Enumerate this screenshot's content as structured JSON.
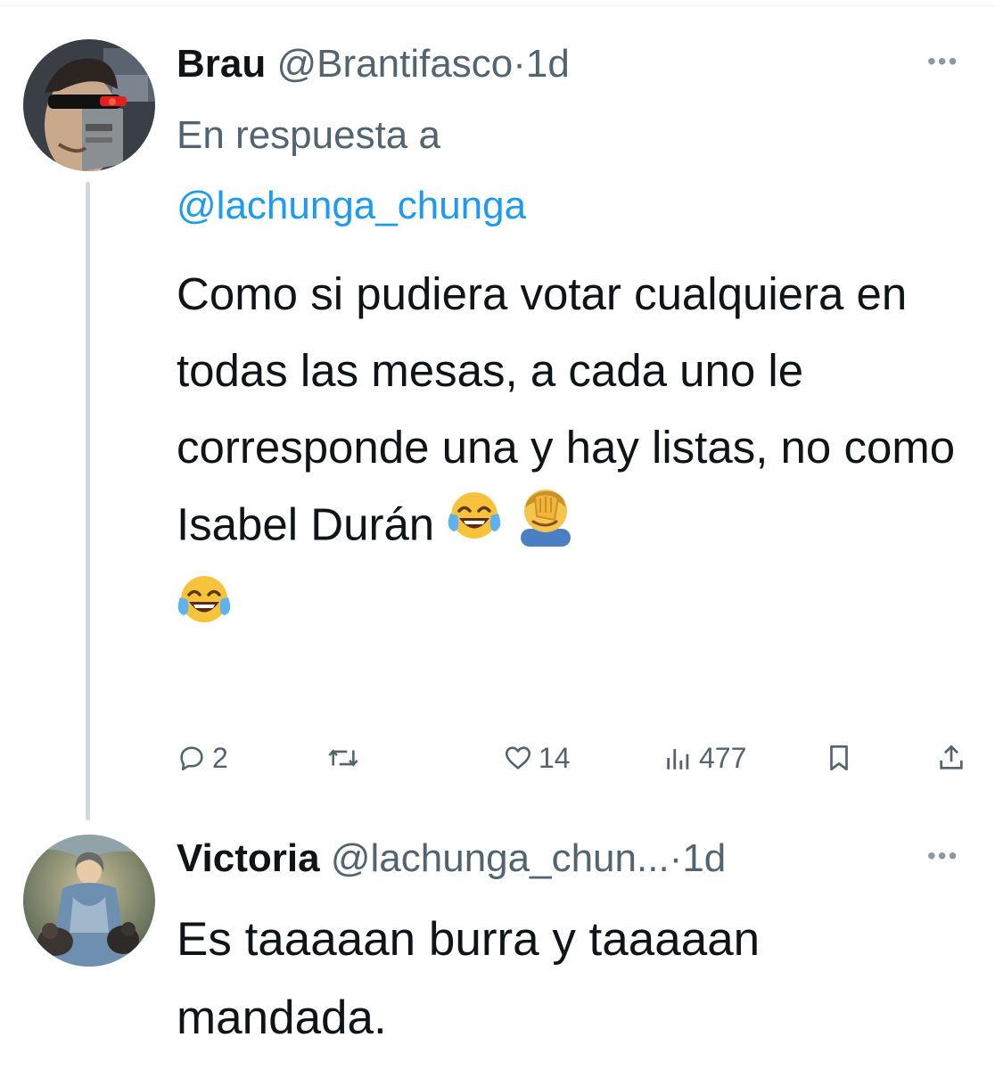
{
  "tweets": [
    {
      "author_name": "Brau",
      "author_handle": "@Brantifasco",
      "separator": "·",
      "time": "1d",
      "reply_label": "En respuesta a",
      "reply_to": "@lachunga_chunga",
      "text": "Como si pudiera votar cualquiera en todas las mesas, a cada uno le corresponde una y hay listas, no como Isabel Durán",
      "emojis": [
        "tears-of-joy-emoji",
        "facepalm-emoji",
        "tears-of-joy-emoji"
      ],
      "stats": {
        "replies": "2",
        "likes": "14",
        "views": "477"
      }
    },
    {
      "author_name": "Victoria",
      "author_handle": "@lachunga_chun...",
      "separator": "·",
      "time": "1d",
      "text": "Es taaaaan burra y taaaaan mandada."
    }
  ],
  "more_label": "•••",
  "colors": {
    "text": "#0f1419",
    "secondary": "#536471",
    "link": "#1d9bf0",
    "thread_line": "#cfd9de"
  }
}
